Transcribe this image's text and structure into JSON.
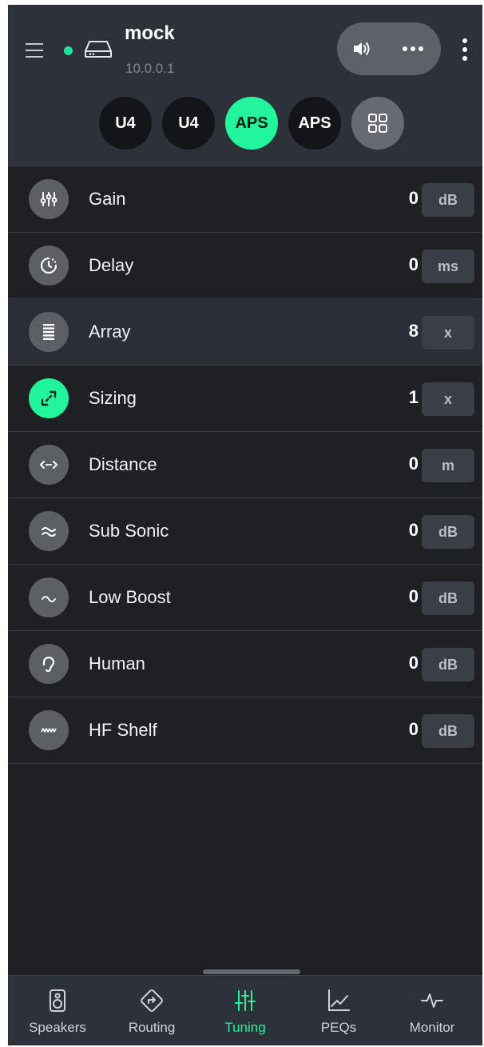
{
  "header": {
    "device_name": "mock",
    "device_ip": "10.0.0.1",
    "status_color": "#22e39a",
    "icons": {
      "menu": "hamburger-menu-icon",
      "device": "hard-drive-icon",
      "volume": "speaker-volume-icon",
      "more": "more-horizontal-icon",
      "kebab": "more-vertical-icon"
    }
  },
  "channel_tabs": [
    {
      "label": "U4",
      "active": false
    },
    {
      "label": "U4",
      "active": false
    },
    {
      "label": "APS",
      "active": true
    },
    {
      "label": "APS",
      "active": false
    },
    {
      "label": "",
      "icon": "grid-icon",
      "active": false
    }
  ],
  "params": [
    {
      "label": "Gain",
      "value": "0",
      "unit": "dB",
      "icon": "sliders-icon"
    },
    {
      "label": "Delay",
      "value": "0",
      "unit": "ms",
      "icon": "timer-icon"
    },
    {
      "label": "Array",
      "value": "8",
      "unit": "x",
      "icon": "array-icon",
      "selected": true
    },
    {
      "label": "Sizing",
      "value": "1",
      "unit": "x",
      "icon": "expand-icon",
      "active": true
    },
    {
      "label": "Distance",
      "value": "0",
      "unit": "m",
      "icon": "arrows-horizontal-icon"
    },
    {
      "label": "Sub Sonic",
      "value": "0",
      "unit": "dB",
      "icon": "wave-approx-icon"
    },
    {
      "label": "Low Boost",
      "value": "0",
      "unit": "dB",
      "icon": "low-wave-icon"
    },
    {
      "label": "Human",
      "value": "0",
      "unit": "dB",
      "icon": "ear-icon"
    },
    {
      "label": "HF Shelf",
      "value": "0",
      "unit": "dB",
      "icon": "zigzag-icon"
    }
  ],
  "bottom_nav": [
    {
      "label": "Speakers",
      "icon": "speaker-icon",
      "active": false
    },
    {
      "label": "Routing",
      "icon": "routing-icon",
      "active": false
    },
    {
      "label": "Tuning",
      "icon": "tuning-sliders-icon",
      "active": true
    },
    {
      "label": "PEQs",
      "icon": "graph-icon",
      "active": false
    },
    {
      "label": "Monitor",
      "icon": "pulse-icon",
      "active": false
    }
  ],
  "colors": {
    "accent": "#22f59c",
    "background": "#1f2024",
    "header": "#2c313a"
  }
}
